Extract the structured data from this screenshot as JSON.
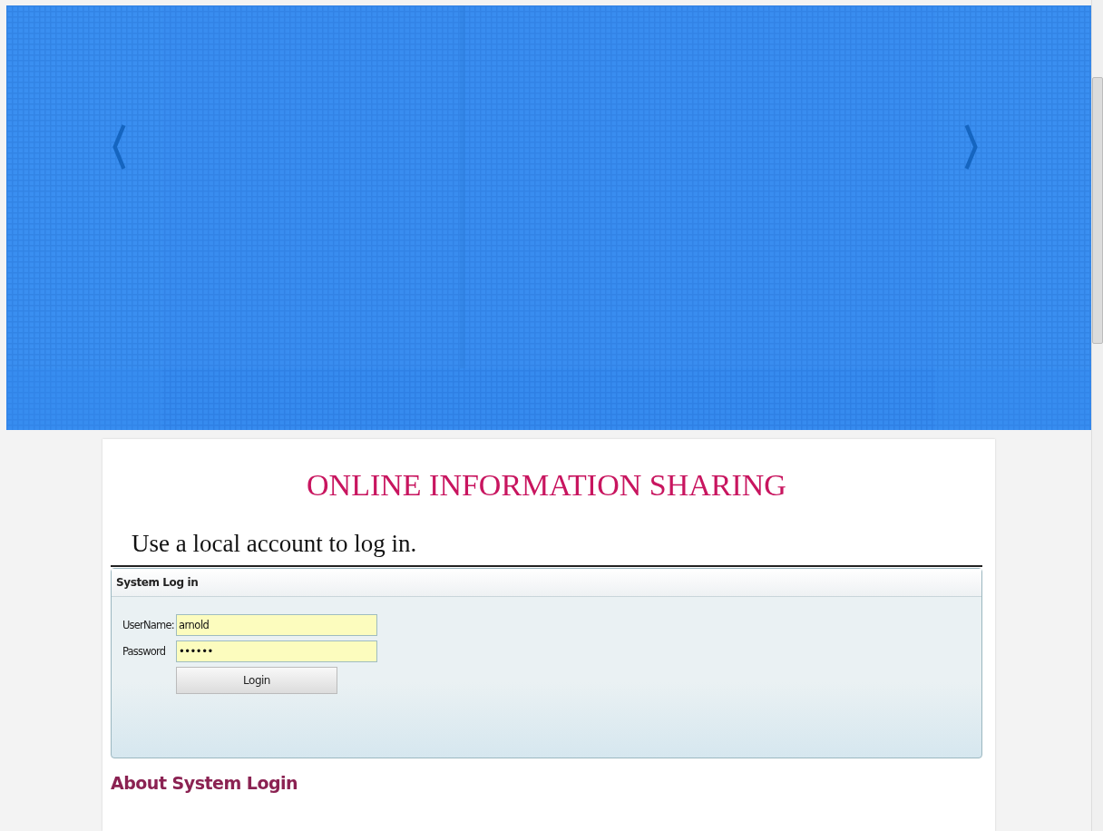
{
  "title": "ONLINE INFORMATION SHARING",
  "subtitle": "Use a local account to log in.",
  "login_panel": {
    "title": "System Log in",
    "fields": [
      {
        "label": "UserName:",
        "value": "arnold"
      },
      {
        "label": "Password",
        "value": "••••••"
      }
    ],
    "button": "Login"
  },
  "about_heading": "About System Login"
}
